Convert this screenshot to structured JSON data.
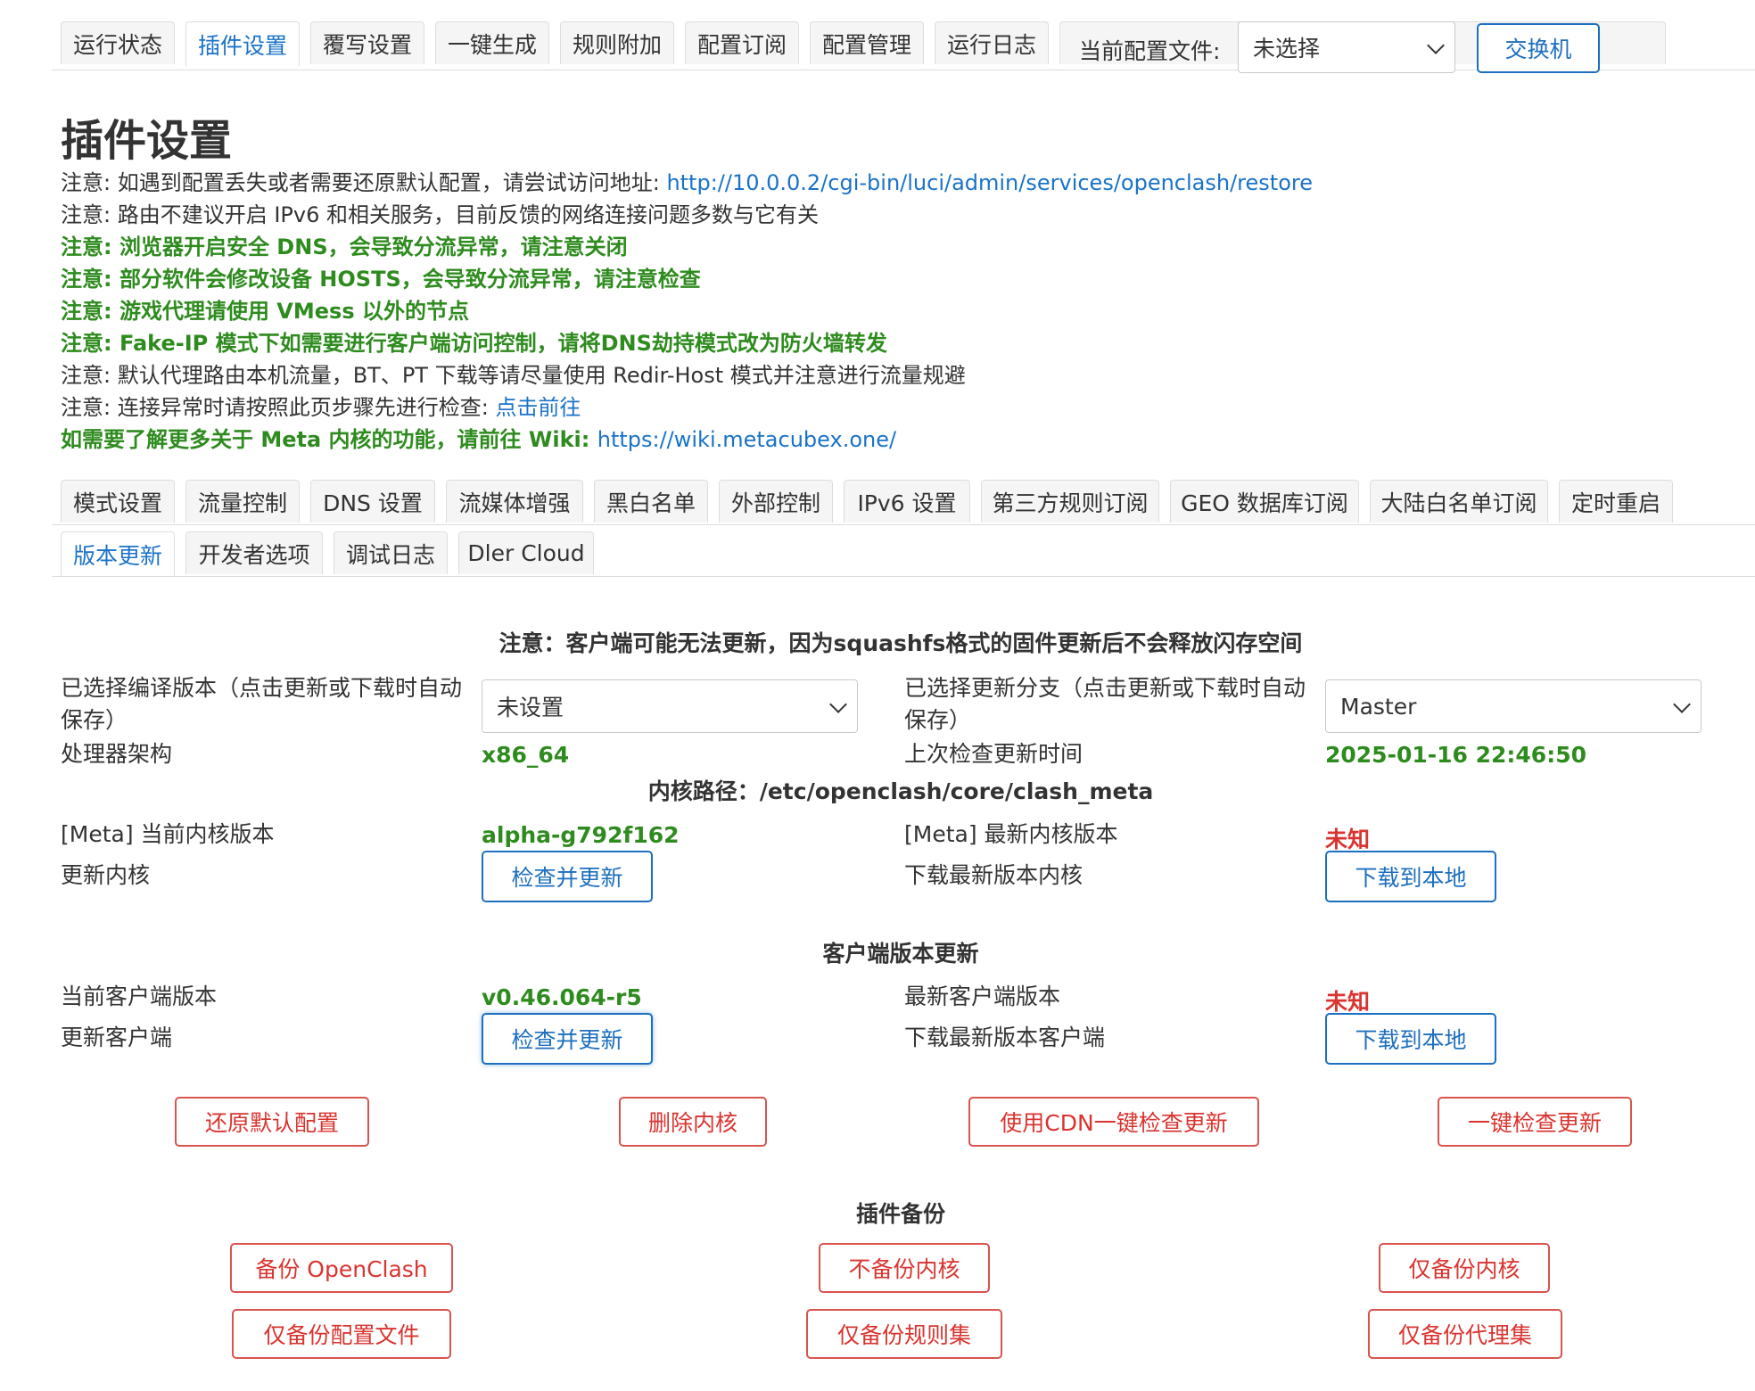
{
  "top_tabs": [
    "运行状态",
    "插件设置",
    "覆写设置",
    "一键生成",
    "规则附加",
    "配置订阅",
    "配置管理",
    "运行日志"
  ],
  "active_top_tab": "插件设置",
  "config_file": {
    "label": "当前配置文件:",
    "value": "未选择",
    "switch_button": "交换机"
  },
  "page_title": "插件设置",
  "notes": {
    "n1_text": "注意: 如遇到配置丢失或者需要还原默认配置，请尝试访问地址: ",
    "n1_link": "http://10.0.0.2/cgi-bin/luci/admin/services/openclash/restore",
    "n2": "注意: 路由不建议开启 IPv6 和相关服务，目前反馈的网络连接问题多数与它有关",
    "n3": "注意: 浏览器开启安全 DNS，会导致分流异常，请注意关闭",
    "n4": "注意: 部分软件会修改设备 HOSTS，会导致分流异常，请注意检查",
    "n5": "注意: 游戏代理请使用 VMess 以外的节点",
    "n6": "注意: Fake-IP 模式下如需要进行客户端访问控制，请将DNS劫持模式改为防火墙转发",
    "n7": "注意: 默认代理路由本机流量，BT、PT 下载等请尽量使用 Redir-Host 模式并注意进行流量规避",
    "n8_text": "注意: 连接异常时请按照此页步骤先进行检查: ",
    "n8_link": "点击前往",
    "n9_text": "如需要了解更多关于 Meta 内核的功能，请前往 Wiki: ",
    "n9_link": "https://wiki.metacubex.one/"
  },
  "sub_tabs_row1": [
    "模式设置",
    "流量控制",
    "DNS 设置",
    "流媒体增强",
    "黑白名单",
    "外部控制",
    "IPv6 设置",
    "第三方规则订阅",
    "GEO 数据库订阅",
    "大陆白名单订阅",
    "定时重启"
  ],
  "sub_tabs_row2": [
    "版本更新",
    "开发者选项",
    "调试日志",
    "Dler Cloud"
  ],
  "active_sub_tab": "版本更新",
  "update": {
    "warning": "注意：客户端可能无法更新，因为squashfs格式的固件更新后不会释放闪存空间",
    "compile_label": "已选择编译版本（点击更新或下载时自动保存）",
    "compile_value": "未设置",
    "branch_label": "已选择更新分支（点击更新或下载时自动保存）",
    "branch_value": "Master",
    "arch_label": "处理器架构",
    "arch_value": "x86_64",
    "last_check_label": "上次检查更新时间",
    "last_check_value": "2025-01-16 22:46:50",
    "core_path": "内核路径：/etc/openclash/core/clash_meta",
    "cur_core_label": "[Meta] 当前内核版本",
    "cur_core_value": "alpha-g792f162",
    "latest_core_label": "[Meta] 最新内核版本",
    "latest_core_value": "未知",
    "update_core_label": "更新内核",
    "update_core_btn": "检查并更新",
    "download_core_label": "下载最新版本内核",
    "download_core_btn": "下载到本地",
    "client_section": "客户端版本更新",
    "cur_client_label": "当前客户端版本",
    "cur_client_value": "v0.46.064-r5",
    "latest_client_label": "最新客户端版本",
    "latest_client_value": "未知",
    "update_client_label": "更新客户端",
    "update_client_btn": "检查并更新",
    "download_client_label": "下载最新版本客户端",
    "download_client_btn": "下载到本地",
    "actions": [
      "还原默认配置",
      "删除内核",
      "使用CDN一键检查更新",
      "一键检查更新"
    ]
  },
  "backup": {
    "title": "插件备份",
    "buttons": [
      "备份 OpenClash",
      "不备份内核",
      "仅备份内核",
      "仅备份配置文件",
      "仅备份规则集",
      "仅备份代理集"
    ]
  },
  "colors": {
    "accent": "#1a73c8",
    "green": "#2e8b1e",
    "red": "#d9342f"
  }
}
